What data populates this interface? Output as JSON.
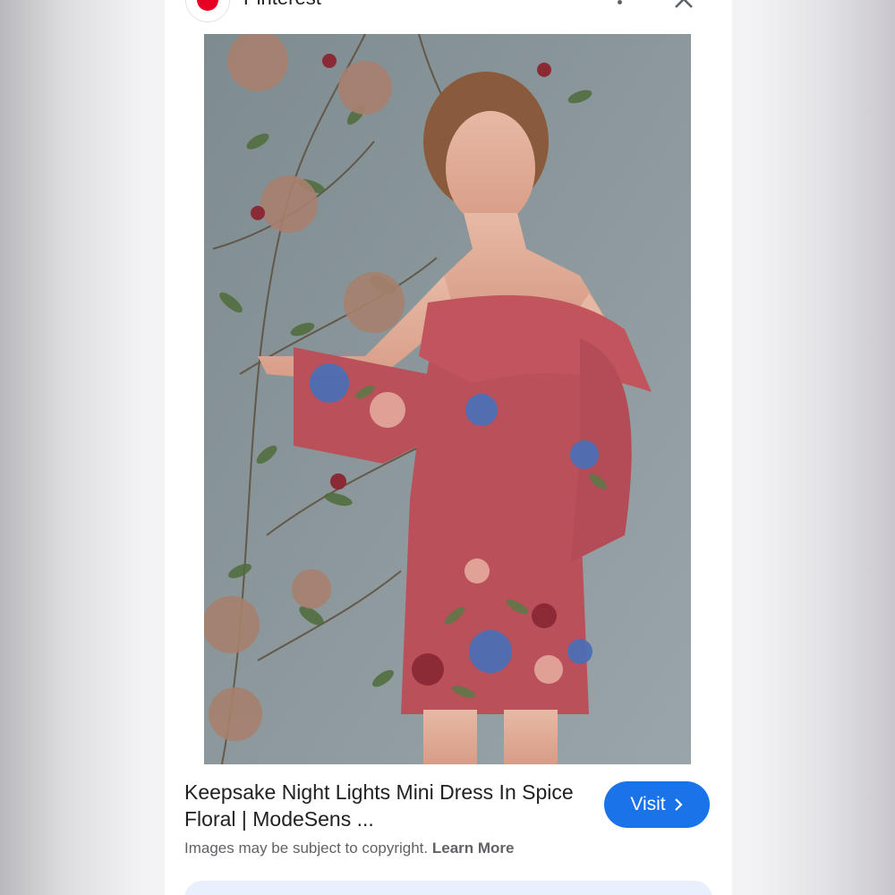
{
  "header": {
    "site_name": "Pinterest",
    "logo_icon": "pinterest-logo-icon",
    "more_icon": "more-vert-icon",
    "close_icon": "close-icon"
  },
  "image": {
    "description_icon": "dress-photo"
  },
  "result": {
    "title": "Keepsake Night Lights Mini Dress In Spice Floral | ModeSens ...",
    "notice": "Images may be subject to copyright.",
    "learn_more": "Learn More",
    "visit_label": "Visit",
    "visit_icon": "chevron-right-icon"
  },
  "colors": {
    "accent": "#1a73e8",
    "brand": "#e60023",
    "dress": "#b9505a",
    "background": "#8d999e"
  }
}
